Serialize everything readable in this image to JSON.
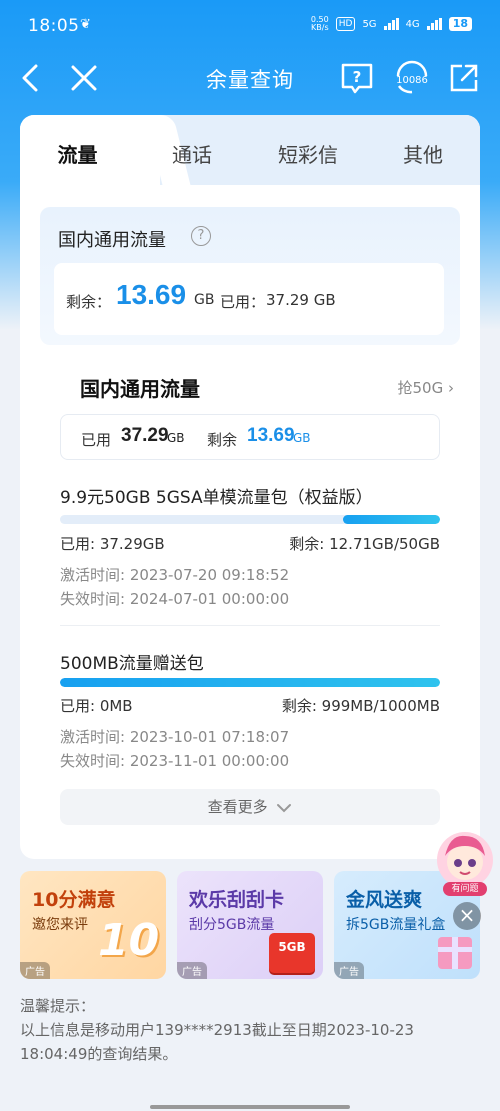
{
  "status_bar": {
    "time": "18:05",
    "speed_value": "0.50",
    "speed_unit": "KB/s",
    "hd": "HD",
    "network_1": "5G",
    "network_2": "4G",
    "battery": "18"
  },
  "nav": {
    "title": "余量查询",
    "service_number": "10086"
  },
  "tabs": [
    {
      "label": "流量",
      "active": true
    },
    {
      "label": "通话",
      "active": false
    },
    {
      "label": "短彩信",
      "active": false
    },
    {
      "label": "其他",
      "active": false
    }
  ],
  "summary": {
    "title": "国内通用流量",
    "remaining_label": "剩余：",
    "remaining_value": "13.69",
    "remaining_unit": "GB",
    "used_label": "已用：",
    "used_value": "37.29 GB"
  },
  "section": {
    "title": "国内通用流量",
    "link": "抢50G",
    "used_label": "已用",
    "used_value": "37.29",
    "used_unit": "GB",
    "remain_label": "剩余",
    "remain_value": "13.69",
    "remain_unit": "GB"
  },
  "packages": [
    {
      "name": "9.9元50GB 5GSA单模流量包（权益版）",
      "used_fraction": 0.746,
      "used_text": "已用: 37.29GB",
      "remain_text": "剩余: 12.71GB/50GB",
      "activated": "激活时间: 2023-07-20 09:18:52",
      "expires": "失效时间: 2024-07-01 00:00:00"
    },
    {
      "name": "500MB流量赠送包",
      "used_fraction": 0.0,
      "used_text": "已用: 0MB",
      "remain_text": "剩余: 999MB/1000MB",
      "activated": "激活时间: 2023-10-01 07:18:07",
      "expires": "失效时间: 2023-11-01 00:00:00"
    }
  ],
  "more_label": "查看更多",
  "ads": [
    {
      "title": "10分满意",
      "subtitle": "邀您来评",
      "deco": "10",
      "tag": "广告"
    },
    {
      "title": "欢乐刮刮卡",
      "subtitle": "刮分5GB流量",
      "deco": "5GB",
      "tag": "广告"
    },
    {
      "title": "金风送爽",
      "subtitle": "拆5GB流量礼盒",
      "tag": "广告"
    }
  ],
  "float_help": {
    "label": "有问题"
  },
  "notice": {
    "title": "温馨提示：",
    "line1": "以上信息是移动用户139****2913截止至日期2023-10-23",
    "line2": "18:04:49的查询结果。"
  },
  "colors": {
    "brand_blue": "#1a9af7",
    "value_blue": "#1a8fe8"
  }
}
